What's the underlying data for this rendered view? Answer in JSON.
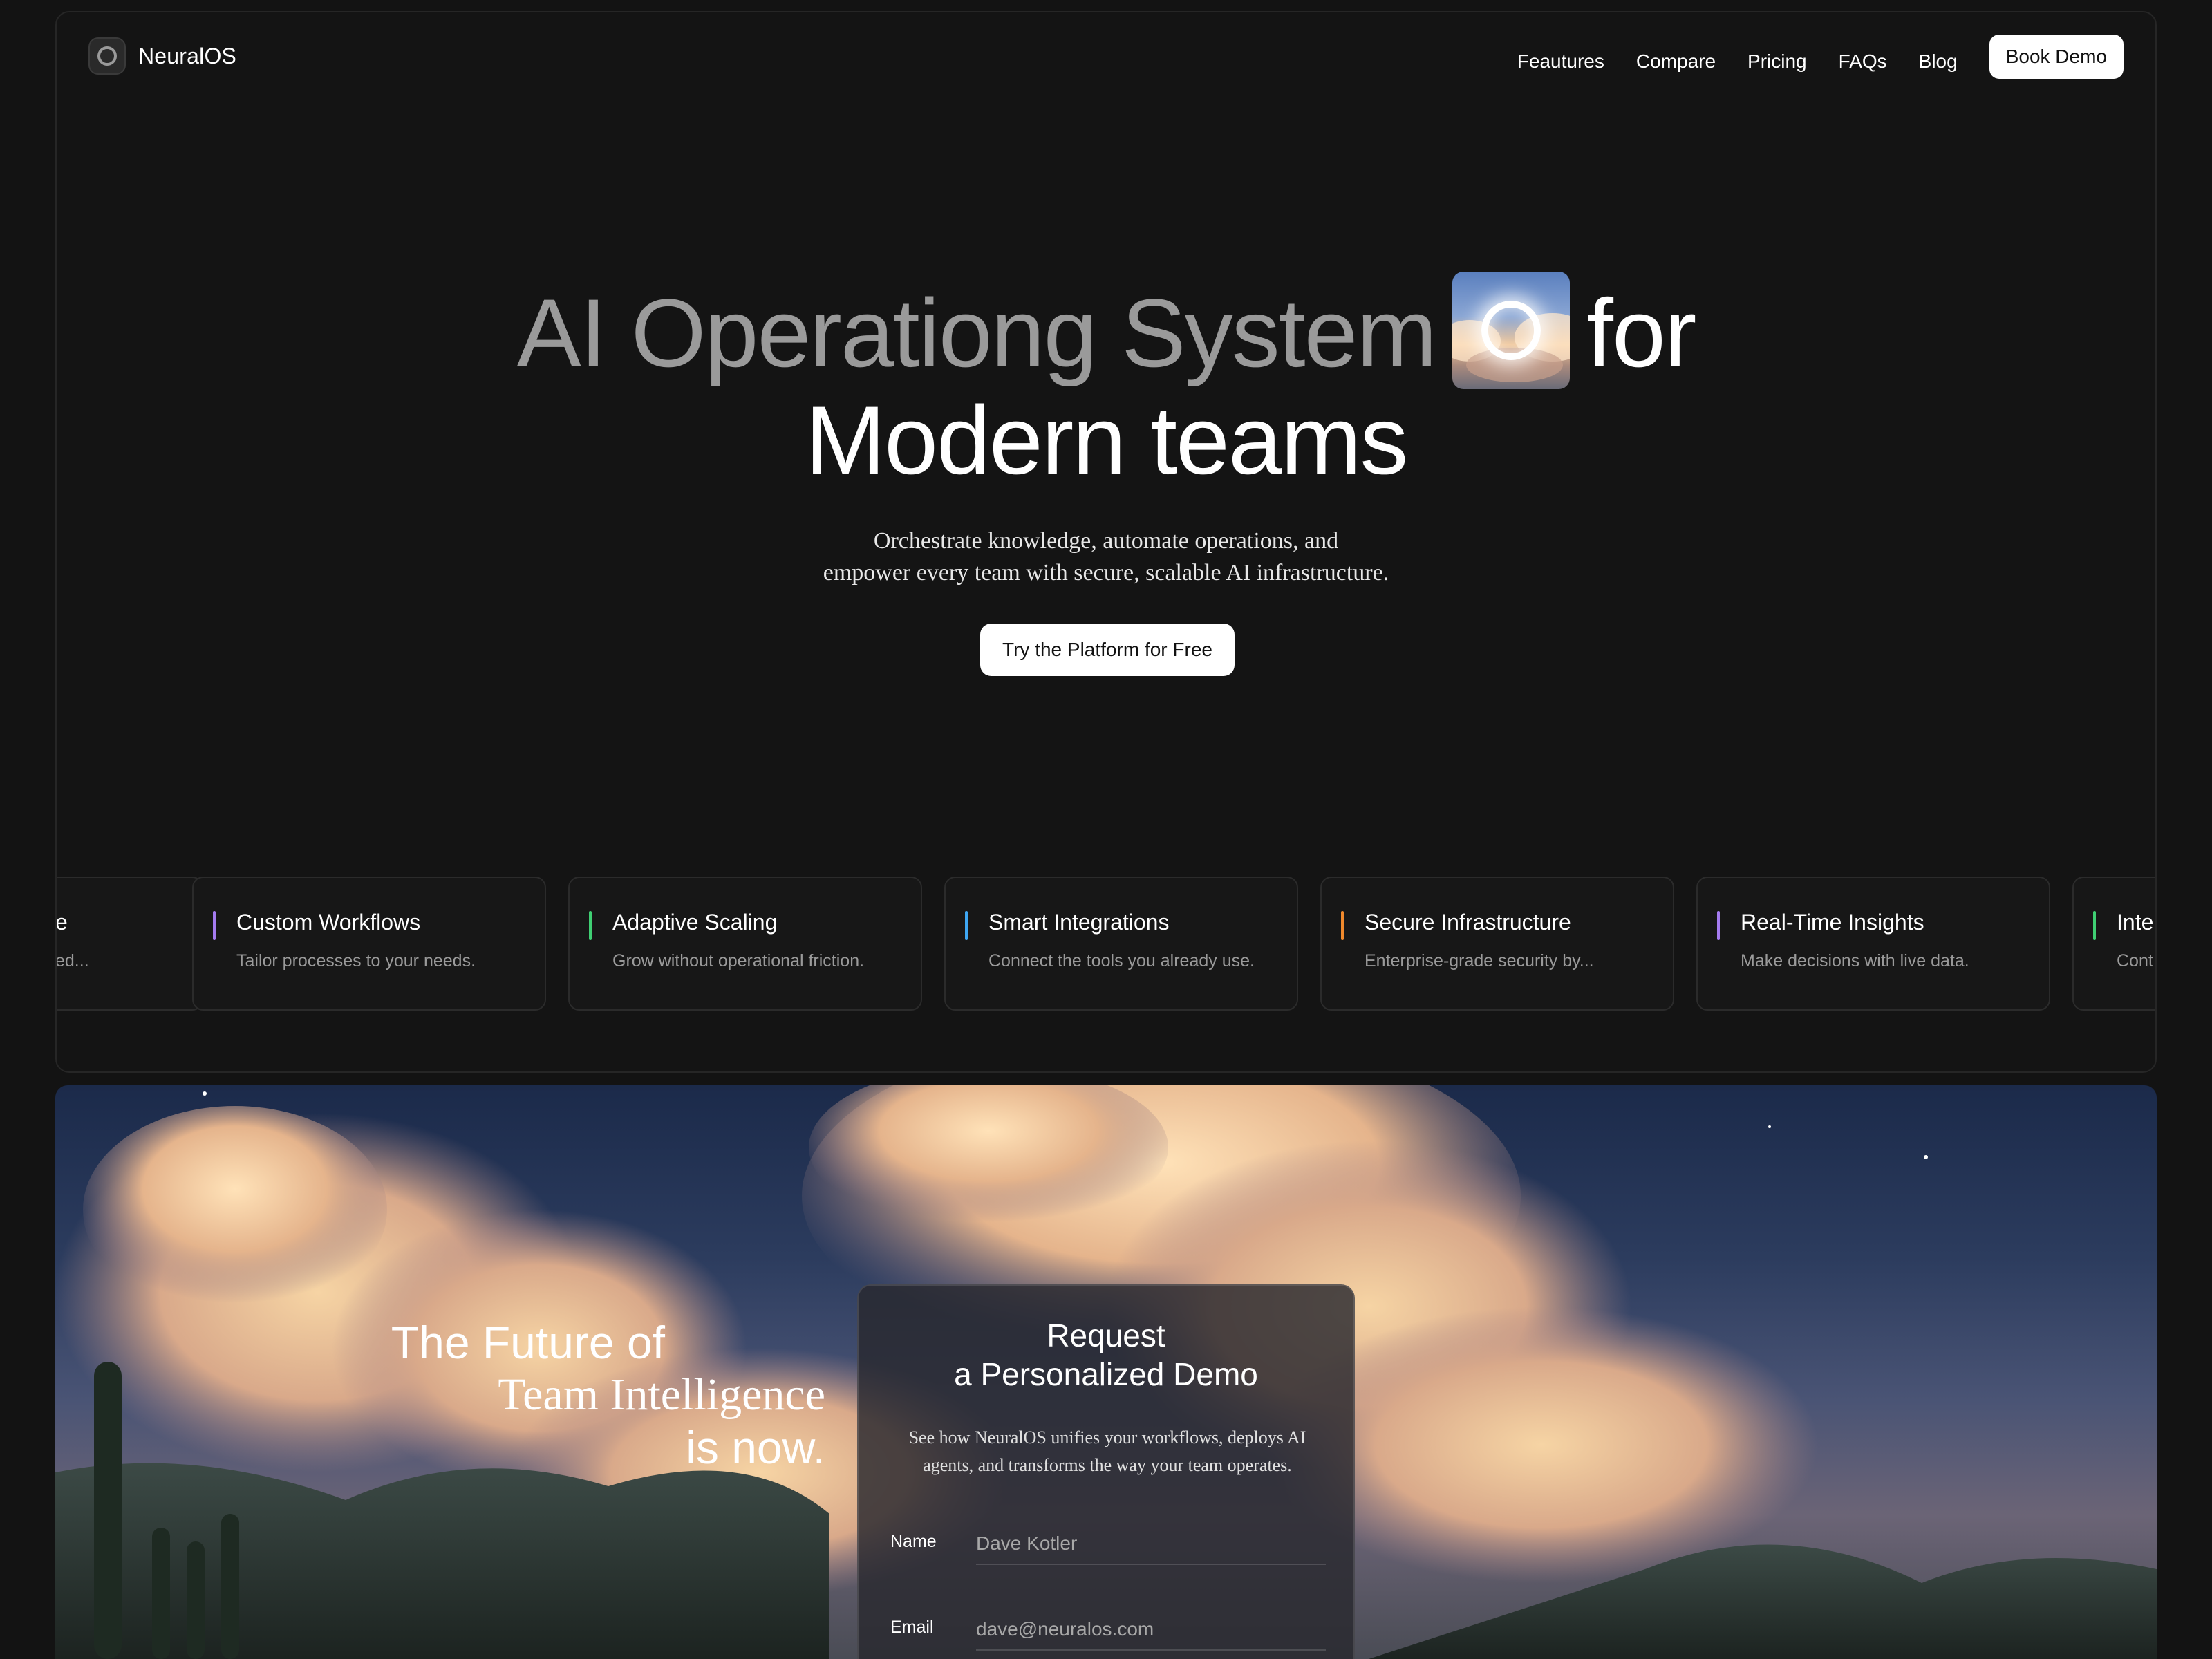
{
  "brand": {
    "name": "NeuralOS"
  },
  "nav": {
    "links": [
      "Feautures",
      "Compare",
      "Pricing",
      "FAQs",
      "Blog"
    ],
    "cta": "Book Demo"
  },
  "hero": {
    "headline_muted": "AI Operationg System",
    "headline_for": "for",
    "headline_line2": "Modern teams",
    "sub_line1": "Orchestrate knowledge, automate operations, and",
    "sub_line2": "empower every team with secure, scalable AI infrastructure.",
    "cta": "Try the Platform for Free"
  },
  "features": [
    {
      "title": "e",
      "desc": "ed...",
      "color": "#a47bf0"
    },
    {
      "title": "Custom Workflows",
      "desc": "Tailor processes to your needs.",
      "color": "#a47bf0"
    },
    {
      "title": "Adaptive Scaling",
      "desc": "Grow without operational friction.",
      "color": "#3fcf73"
    },
    {
      "title": "Smart Integrations",
      "desc": "Connect the tools you already use.",
      "color": "#3ea6f2"
    },
    {
      "title": "Secure Infrastructure",
      "desc": "Enterprise-grade security by...",
      "color": "#f0892c"
    },
    {
      "title": "Real-Time Insights",
      "desc": "Make decisions with live data.",
      "color": "#a47bf0"
    },
    {
      "title": "Intel",
      "desc": "Cont",
      "color": "#3fcf73"
    }
  ],
  "future": {
    "line1": "The Future of",
    "line2": "Team Intelligence",
    "line3": "is now."
  },
  "demo_form": {
    "title_line1": "Request",
    "title_line2": "a Personalized Demo",
    "desc": "See how NeuralOS unifies your workflows, deploys AI agents, and transforms the way your team operates.",
    "fields": [
      {
        "label": "Name",
        "placeholder": "Dave Kotler"
      },
      {
        "label": "Email",
        "placeholder": "dave@neuralos.com"
      }
    ]
  }
}
